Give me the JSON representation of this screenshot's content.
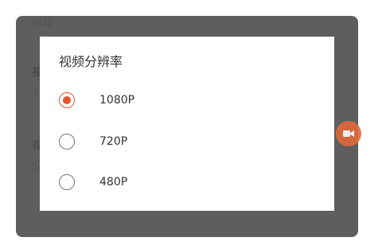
{
  "background": {
    "auto_label": "自动",
    "section1_heading": "视",
    "section1_sub": "7",
    "section2_heading": "视",
    "section2_sub": "5"
  },
  "dialog": {
    "title": "视频分辨率",
    "options": [
      {
        "label": "1080P",
        "selected": true
      },
      {
        "label": "720P",
        "selected": false
      },
      {
        "label": "480P",
        "selected": false
      }
    ]
  },
  "floating_button": {
    "icon": "video-camera-icon",
    "color": "#e06a3c"
  },
  "colors": {
    "accent": "#e8522f",
    "scrim": "#505050"
  }
}
